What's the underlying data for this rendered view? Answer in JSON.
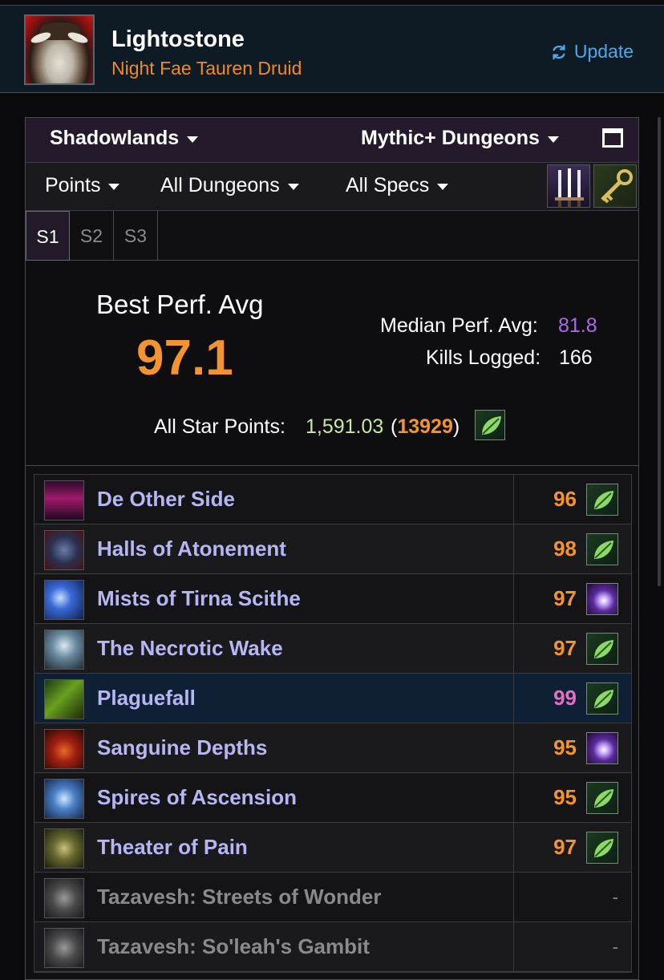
{
  "character": {
    "name": "Lightostone",
    "subtitle": "Night Fae Tauren Druid",
    "update_label": "Update"
  },
  "filters": {
    "expansion": "Shadowlands",
    "content": "Mythic+ Dungeons",
    "metric": "Points",
    "dungeons": "All Dungeons",
    "specs": "All Specs"
  },
  "season_tabs": [
    "S1",
    "S2",
    "S3"
  ],
  "active_tab": "S1",
  "summary": {
    "best_label": "Best Perf. Avg",
    "best_value": "97.1",
    "median_label": "Median Perf. Avg:",
    "median_value": "81.8",
    "kills_label": "Kills Logged:",
    "kills_value": "166",
    "star_label": "All Star Points:",
    "star_value": "1,591.03",
    "star_rank": "13929"
  },
  "colors": {
    "accent_orange": "#f29432",
    "link_blue": "#4fa8e8",
    "dungeon_name": "#b6b6f4",
    "median_purple": "#a86ae8",
    "legendary_pink": "#e070c0",
    "highlight_row": "#0f2034"
  },
  "dungeons": [
    {
      "name": "De Other Side",
      "score": "96",
      "icon": "leaf-icon"
    },
    {
      "name": "Halls of Atonement",
      "score": "98",
      "icon": "leaf-icon"
    },
    {
      "name": "Mists of Tirna Scithe",
      "score": "97",
      "icon": "spark-icon"
    },
    {
      "name": "The Necrotic Wake",
      "score": "97",
      "icon": "leaf-icon"
    },
    {
      "name": "Plaguefall",
      "score": "99",
      "icon": "leaf-icon"
    },
    {
      "name": "Sanguine Depths",
      "score": "95",
      "icon": "spark-icon"
    },
    {
      "name": "Spires of Ascension",
      "score": "95",
      "icon": "leaf-icon"
    },
    {
      "name": "Theater of Pain",
      "score": "97",
      "icon": "leaf-icon"
    },
    {
      "name": "Tazavesh: Streets of Wonder",
      "score": "-",
      "icon": ""
    },
    {
      "name": "Tazavesh: So'leah's Gambit",
      "score": "-",
      "icon": ""
    }
  ]
}
